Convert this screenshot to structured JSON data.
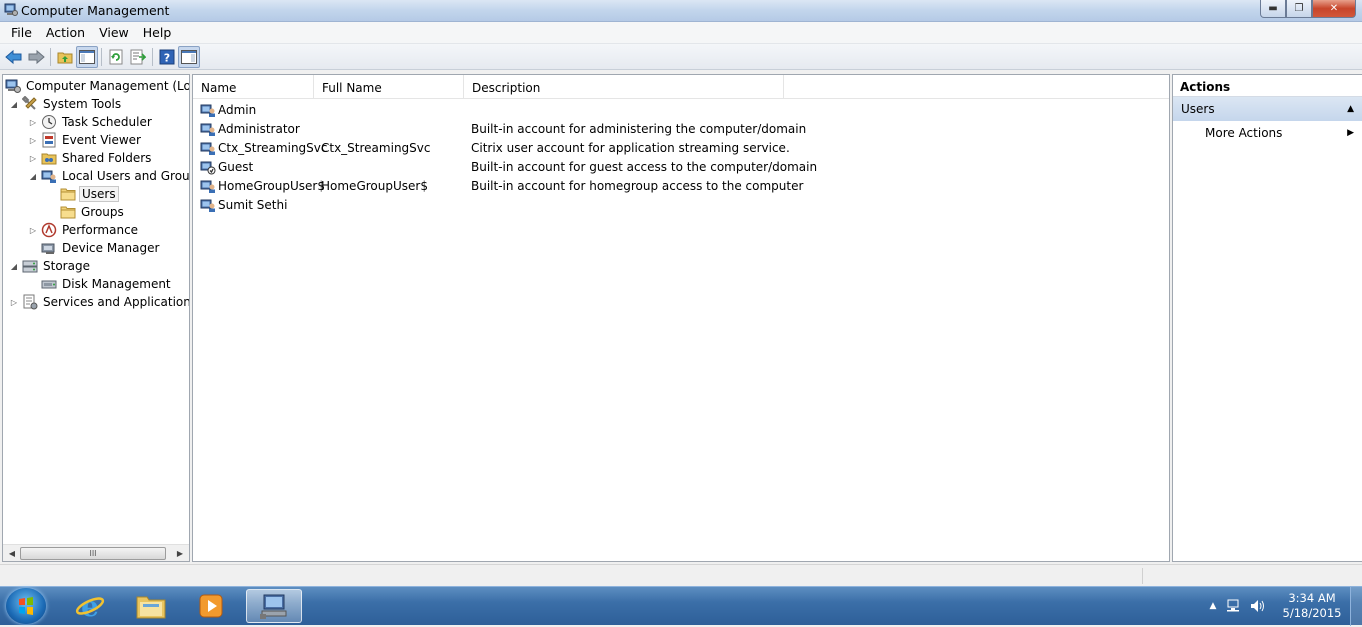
{
  "window": {
    "title": "Computer Management"
  },
  "menu": [
    "File",
    "Action",
    "View",
    "Help"
  ],
  "tree": [
    {
      "label": "Computer Management (Local",
      "icon": "computer-management-icon",
      "exp": ""
    },
    {
      "label": "System Tools",
      "icon": "system-tools-icon",
      "exp": "◢"
    },
    {
      "label": "Task Scheduler",
      "icon": "clock-icon",
      "exp": "▷"
    },
    {
      "label": "Event Viewer",
      "icon": "event-viewer-icon",
      "exp": "▷"
    },
    {
      "label": "Shared Folders",
      "icon": "shared-folder-icon",
      "exp": "▷"
    },
    {
      "label": "Local Users and Groups",
      "icon": "users-groups-icon",
      "exp": "◢"
    },
    {
      "label": "Users",
      "icon": "folder-icon",
      "exp": ""
    },
    {
      "label": "Groups",
      "icon": "folder-icon",
      "exp": ""
    },
    {
      "label": "Performance",
      "icon": "performance-icon",
      "exp": "▷"
    },
    {
      "label": "Device Manager",
      "icon": "device-manager-icon",
      "exp": ""
    },
    {
      "label": "Storage",
      "icon": "storage-icon",
      "exp": "◢"
    },
    {
      "label": "Disk Management",
      "icon": "disk-icon",
      "exp": ""
    },
    {
      "label": "Services and Applications",
      "icon": "services-icon",
      "exp": "▷"
    }
  ],
  "columns": [
    "Name",
    "Full Name",
    "Description"
  ],
  "users": [
    {
      "name": "Admin",
      "full_name": "",
      "description": ""
    },
    {
      "name": "Administrator",
      "full_name": "",
      "description": "Built-in account for administering the computer/domain"
    },
    {
      "name": "Ctx_StreamingSvc",
      "full_name": "Ctx_StreamingSvc",
      "description": "Citrix user account for application streaming service."
    },
    {
      "name": "Guest",
      "full_name": "",
      "description": "Built-in account for guest access to the computer/domain"
    },
    {
      "name": "HomeGroupUser$",
      "full_name": "HomeGroupUser$",
      "description": "Built-in account for homegroup access to the computer"
    },
    {
      "name": "Sumit Sethi",
      "full_name": "",
      "description": ""
    }
  ],
  "actions": {
    "header": "Actions",
    "section": "Users",
    "more": "More Actions"
  },
  "scrollbar": {
    "thumb_label": "III"
  },
  "clock": {
    "time": "3:34 AM",
    "date": "5/18/2015"
  }
}
